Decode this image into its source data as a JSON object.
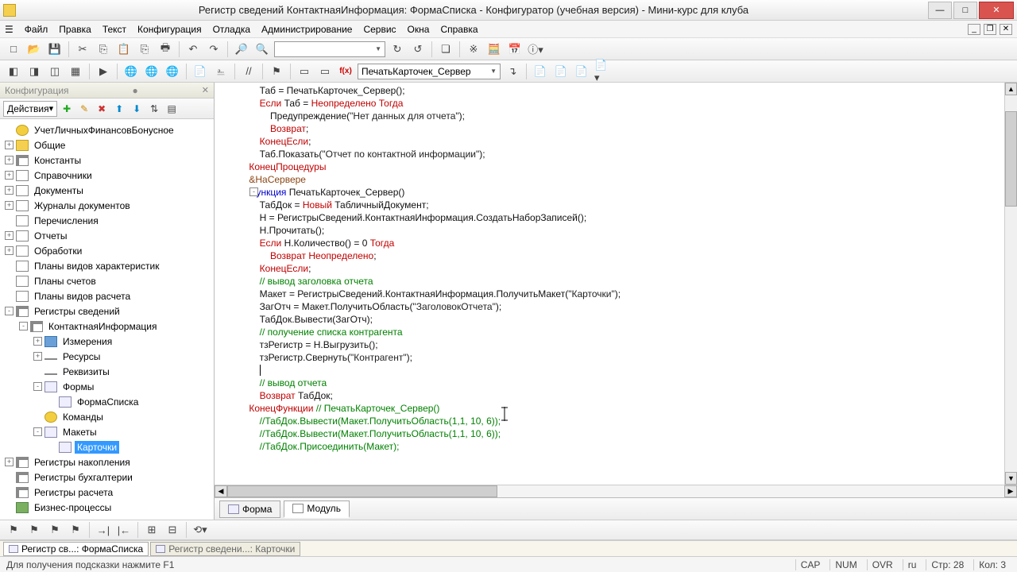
{
  "window": {
    "title": "Регистр сведений КонтактнаяИнформация: ФормаСписка - Конфигуратор (учебная версия) - Мини-курс для клуба"
  },
  "menu": [
    "Файл",
    "Правка",
    "Текст",
    "Конфигурация",
    "Отладка",
    "Администрирование",
    "Сервис",
    "Окна",
    "Справка"
  ],
  "toolbar2": {
    "combo": "ПечатьКарточек_Сервер"
  },
  "config_panel": {
    "title": "Конфигурация",
    "actions_label": "Действия"
  },
  "tree": [
    {
      "d": 0,
      "exp": "",
      "icon": "yellow",
      "lbl": "УчетЛичныхФинансовБонусное"
    },
    {
      "d": 0,
      "exp": "+",
      "icon": "folder",
      "lbl": "Общие"
    },
    {
      "d": 0,
      "exp": "+",
      "icon": "grid",
      "lbl": "Константы"
    },
    {
      "d": 0,
      "exp": "+",
      "icon": "doc",
      "lbl": "Справочники"
    },
    {
      "d": 0,
      "exp": "+",
      "icon": "doc",
      "lbl": "Документы"
    },
    {
      "d": 0,
      "exp": "+",
      "icon": "doc",
      "lbl": "Журналы документов"
    },
    {
      "d": 0,
      "exp": "",
      "icon": "doc",
      "lbl": "Перечисления"
    },
    {
      "d": 0,
      "exp": "+",
      "icon": "doc",
      "lbl": "Отчеты"
    },
    {
      "d": 0,
      "exp": "+",
      "icon": "doc",
      "lbl": "Обработки"
    },
    {
      "d": 0,
      "exp": "",
      "icon": "doc",
      "lbl": "Планы видов характеристик"
    },
    {
      "d": 0,
      "exp": "",
      "icon": "doc",
      "lbl": "Планы счетов"
    },
    {
      "d": 0,
      "exp": "",
      "icon": "doc",
      "lbl": "Планы видов расчета"
    },
    {
      "d": 0,
      "exp": "-",
      "icon": "grid",
      "lbl": "Регистры сведений"
    },
    {
      "d": 1,
      "exp": "-",
      "icon": "grid",
      "lbl": "КонтактнаяИнформация"
    },
    {
      "d": 2,
      "exp": "+",
      "icon": "blue",
      "lbl": "Измерения"
    },
    {
      "d": 2,
      "exp": "+",
      "icon": "line",
      "lbl": "Ресурсы"
    },
    {
      "d": 2,
      "exp": "",
      "icon": "line",
      "lbl": "Реквизиты"
    },
    {
      "d": 2,
      "exp": "-",
      "icon": "form",
      "lbl": "Формы"
    },
    {
      "d": 3,
      "exp": "",
      "icon": "form",
      "lbl": "ФормаСписка"
    },
    {
      "d": 2,
      "exp": "",
      "icon": "yellow",
      "lbl": "Команды"
    },
    {
      "d": 2,
      "exp": "-",
      "icon": "form",
      "lbl": "Макеты"
    },
    {
      "d": 3,
      "exp": "",
      "icon": "form",
      "lbl": "Карточки",
      "sel": true
    },
    {
      "d": 0,
      "exp": "+",
      "icon": "grid",
      "lbl": "Регистры накопления"
    },
    {
      "d": 0,
      "exp": "",
      "icon": "grid",
      "lbl": "Регистры бухгалтерии"
    },
    {
      "d": 0,
      "exp": "",
      "icon": "grid",
      "lbl": "Регистры расчета"
    },
    {
      "d": 0,
      "exp": "",
      "icon": "green",
      "lbl": "Бизнес-процессы"
    }
  ],
  "code_lines": [
    {
      "ind": 2,
      "seg": [
        {
          "c": "blk",
          "t": "Таб = ПечатьКарточек_Сервер();"
        }
      ]
    },
    {
      "ind": 2,
      "seg": [
        {
          "c": "kw-red",
          "t": "Если"
        },
        {
          "c": "blk",
          "t": " Таб = "
        },
        {
          "c": "kw-red",
          "t": "Неопределено Тогда"
        }
      ]
    },
    {
      "ind": 3,
      "seg": [
        {
          "c": "blk",
          "t": "Предупреждение("
        },
        {
          "c": "str",
          "t": "\"Нет данных для отчета\""
        },
        {
          "c": "blk",
          "t": ");"
        }
      ]
    },
    {
      "ind": 3,
      "seg": [
        {
          "c": "kw-red",
          "t": "Возврат"
        },
        {
          "c": "blk",
          "t": ";"
        }
      ]
    },
    {
      "ind": 2,
      "seg": [
        {
          "c": "kw-red",
          "t": "КонецЕсли"
        },
        {
          "c": "blk",
          "t": ";"
        }
      ]
    },
    {
      "ind": 2,
      "seg": [
        {
          "c": "blk",
          "t": "Таб.Показать("
        },
        {
          "c": "str",
          "t": "\"Отчет по контактной информации\""
        },
        {
          "c": "blk",
          "t": ");"
        }
      ]
    },
    {
      "ind": 1,
      "seg": [
        {
          "c": "kw-red",
          "t": "КонецПроцедуры"
        }
      ]
    },
    {
      "ind": 0,
      "seg": [
        {
          "c": "blk",
          "t": ""
        }
      ]
    },
    {
      "ind": 1,
      "seg": [
        {
          "c": "kw-brown",
          "t": "&НаСервере"
        }
      ]
    },
    {
      "ind": 1,
      "fold": "-",
      "seg": [
        {
          "c": "kw-blue",
          "t": "Функция"
        },
        {
          "c": "blk",
          "t": " ПечатьКарточек_Сервер()"
        }
      ]
    },
    {
      "ind": 2,
      "seg": [
        {
          "c": "blk",
          "t": "ТабДок = "
        },
        {
          "c": "kw-red",
          "t": "Новый"
        },
        {
          "c": "blk",
          "t": " ТабличныйДокумент;"
        }
      ]
    },
    {
      "ind": 2,
      "seg": [
        {
          "c": "blk",
          "t": "Н = РегистрыСведений.КонтактнаяИнформация.СоздатьНаборЗаписей();"
        }
      ]
    },
    {
      "ind": 2,
      "seg": [
        {
          "c": "blk",
          "t": "Н.Прочитать();"
        }
      ]
    },
    {
      "ind": 2,
      "seg": [
        {
          "c": "kw-red",
          "t": "Если"
        },
        {
          "c": "blk",
          "t": " Н.Количество() = 0 "
        },
        {
          "c": "kw-red",
          "t": "Тогда"
        }
      ]
    },
    {
      "ind": 3,
      "seg": [
        {
          "c": "kw-red",
          "t": "Возврат Неопределено"
        },
        {
          "c": "blk",
          "t": ";"
        }
      ]
    },
    {
      "ind": 2,
      "seg": [
        {
          "c": "kw-red",
          "t": "КонецЕсли"
        },
        {
          "c": "blk",
          "t": ";"
        }
      ]
    },
    {
      "ind": 2,
      "seg": [
        {
          "c": "kw-green",
          "t": "// вывод заголовка отчета"
        }
      ]
    },
    {
      "ind": 2,
      "seg": [
        {
          "c": "blk",
          "t": "Макет = РегистрыСведений.КонтактнаяИнформация.ПолучитьМакет("
        },
        {
          "c": "str",
          "t": "\"Карточки\""
        },
        {
          "c": "blk",
          "t": ");"
        }
      ]
    },
    {
      "ind": 2,
      "seg": [
        {
          "c": "blk",
          "t": "ЗагОтч = Макет.ПолучитьОбласть("
        },
        {
          "c": "str",
          "t": "\"ЗаголовокОтчета\""
        },
        {
          "c": "blk",
          "t": ");"
        }
      ]
    },
    {
      "ind": 2,
      "seg": [
        {
          "c": "blk",
          "t": "ТабДок.Вывести(ЗагОтч);"
        }
      ]
    },
    {
      "ind": 2,
      "seg": [
        {
          "c": "kw-green",
          "t": "// получение списка контрагента"
        }
      ]
    },
    {
      "ind": 2,
      "seg": [
        {
          "c": "blk",
          "t": "тзРегистр = Н.Выгрузить();"
        }
      ]
    },
    {
      "ind": 2,
      "seg": [
        {
          "c": "blk",
          "t": "тзРегистр.Свернуть("
        },
        {
          "c": "str",
          "t": "\"Контрагент\""
        },
        {
          "c": "blk",
          "t": ");"
        }
      ]
    },
    {
      "ind": 2,
      "seg": [
        {
          "c": "blk",
          "t": "|"
        }
      ],
      "caret": true
    },
    {
      "ind": 2,
      "seg": [
        {
          "c": "kw-green",
          "t": "// вывод отчета"
        }
      ]
    },
    {
      "ind": 2,
      "seg": [
        {
          "c": "kw-red",
          "t": "Возврат"
        },
        {
          "c": "blk",
          "t": " ТабДок;"
        }
      ]
    },
    {
      "ind": 1,
      "seg": [
        {
          "c": "kw-red",
          "t": "КонецФункции"
        },
        {
          "c": "kw-green",
          "t": " // ПечатьКарточек_Сервер()"
        }
      ]
    },
    {
      "ind": 0,
      "seg": [
        {
          "c": "blk",
          "t": ""
        }
      ]
    },
    {
      "ind": 2,
      "seg": [
        {
          "c": "kw-green",
          "t": "//ТабДок.Вывести(Макет.ПолучитьОбласть(1,1, 10, 6));"
        }
      ]
    },
    {
      "ind": 2,
      "seg": [
        {
          "c": "kw-green",
          "t": "//ТабДок.Вывести(Макет.ПолучитьОбласть(1,1, 10, 6));"
        }
      ]
    },
    {
      "ind": 2,
      "seg": [
        {
          "c": "kw-green",
          "t": "//ТабДок.Присоединить(Макет);"
        }
      ]
    }
  ],
  "bottom_tabs": [
    {
      "lbl": "Форма",
      "icon": "form"
    },
    {
      "lbl": "Модуль",
      "icon": "doc"
    }
  ],
  "doc_tabs": [
    {
      "lbl": "Регистр св...: ФормаСписка",
      "active": true
    },
    {
      "lbl": "Регистр сведени...: Карточки",
      "active": false
    }
  ],
  "status": {
    "hint": "Для получения подсказки нажмите F1",
    "cap": "CAP",
    "num": "NUM",
    "ovr": "OVR",
    "lang": "ru",
    "row": "Стр: 28",
    "col": "Кол: 3"
  }
}
